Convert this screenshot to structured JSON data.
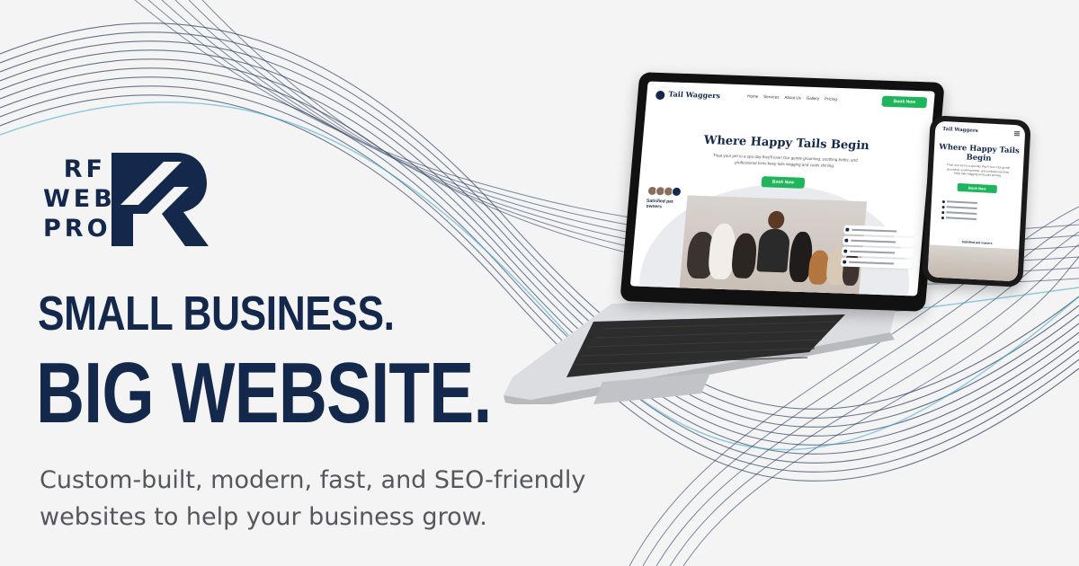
{
  "brand": {
    "logo_lines": [
      "RF",
      "WEB",
      "PRO"
    ],
    "color_primary": "#14284b",
    "color_accent": "#1fb55a"
  },
  "headline": {
    "line1": "SMALL BUSINESS.",
    "line2": "BIG WEBSITE."
  },
  "tagline": "Custom-built, modern, fast, and SEO-friendly websites to help your business grow.",
  "laptop_site": {
    "brand": "Tail Waggers",
    "nav": [
      "Home",
      "Services",
      "About Us",
      "Gallery",
      "Pricing"
    ],
    "cta": "Book Now",
    "hero_title": "Where Happy Tails Begin",
    "hero_text": "Treat your pet to a spa day they'll love! Our gentle grooming, soothing baths, and professional trims keep tails wagging and coats shining.",
    "hero_cta": "Book Now",
    "avatar_count": "2k",
    "satisfied": "Satisfied pet owners"
  },
  "phone_site": {
    "brand": "Tail Waggers",
    "hero_title": "Where Happy Tails Begin",
    "hero_text": "Treat your pet to a spa day they'll love! Our gentle grooming, soothing baths, and professional trims keep tails wagging and coats shining.",
    "hero_cta": "Book Now",
    "satisfied": "Satisfied pet owners"
  },
  "icons": [
    "menu-icon",
    "paw-logo-icon",
    "check-icon"
  ]
}
